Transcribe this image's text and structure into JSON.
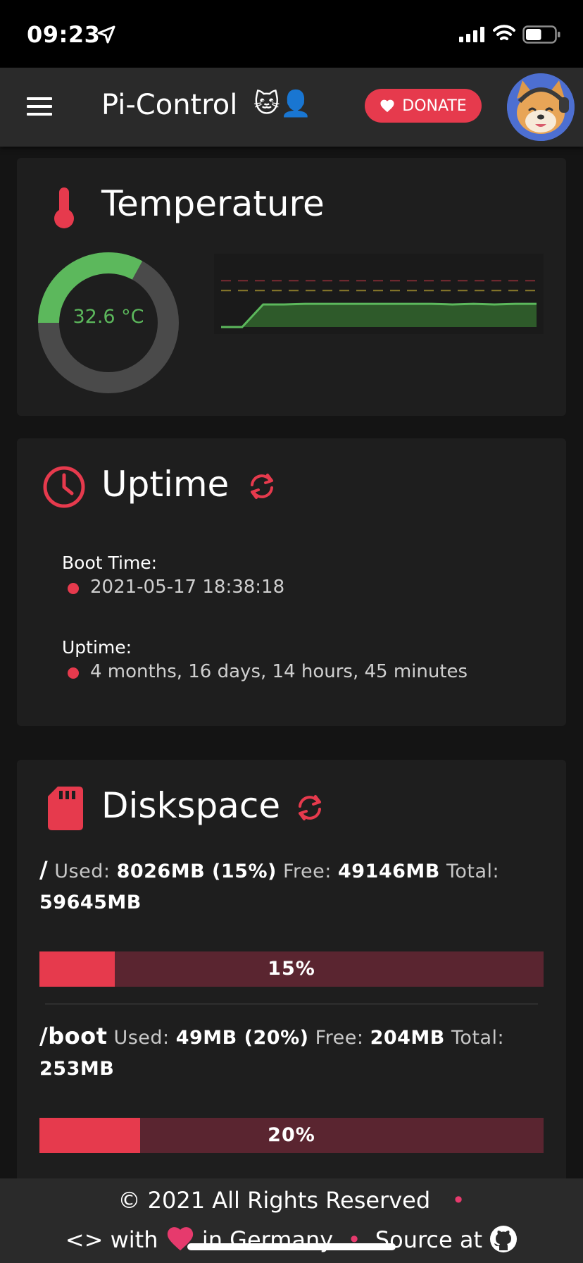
{
  "status_bar": {
    "time": "09:23",
    "battery_level": 0.55
  },
  "header": {
    "title": "Pi-Control",
    "title_emoji": "🐱👤",
    "donate_label": "DONATE"
  },
  "temperature": {
    "title": "Temperature",
    "value_label": "32.6 °C",
    "gauge_fraction": 0.33,
    "colors": {
      "gauge": "#5cb85c",
      "track": "#4a4a4a",
      "warn": "#8a7a2a",
      "crit": "#7a2a33"
    },
    "chart_data": {
      "type": "area",
      "values": [
        0,
        0,
        0.34,
        0.34,
        0.35,
        0.35,
        0.35,
        0.35,
        0.35,
        0.35,
        0.35,
        0.34,
        0.35,
        0.34,
        0.35,
        0.35
      ],
      "ylim": [
        0,
        1
      ],
      "thresholds": [
        0.7,
        0.55
      ]
    }
  },
  "uptime": {
    "title": "Uptime",
    "boot_label": "Boot Time:",
    "boot_value": "2021-05-17 18:38:18",
    "uptime_label": "Uptime:",
    "uptime_value": "4 months, 16 days, 14 hours, 45 minutes"
  },
  "diskspace": {
    "title": "Diskspace",
    "used_label": "Used:",
    "free_label": "Free:",
    "total_label": "Total:",
    "disks": [
      {
        "mount": "/",
        "used": "8026MB (15%)",
        "free": "49146MB",
        "total": "59645MB",
        "percent": 15,
        "percent_label": "15%"
      },
      {
        "mount": "/boot",
        "used": "49MB (20%)",
        "free": "204MB",
        "total": "253MB",
        "percent": 20,
        "percent_label": "20%"
      }
    ]
  },
  "footer": {
    "copyright": "© 2021 All Rights Reserved",
    "code_symbol": "<>",
    "with_text": "with",
    "location_text": "in Germany",
    "source_text": "Source at"
  }
}
